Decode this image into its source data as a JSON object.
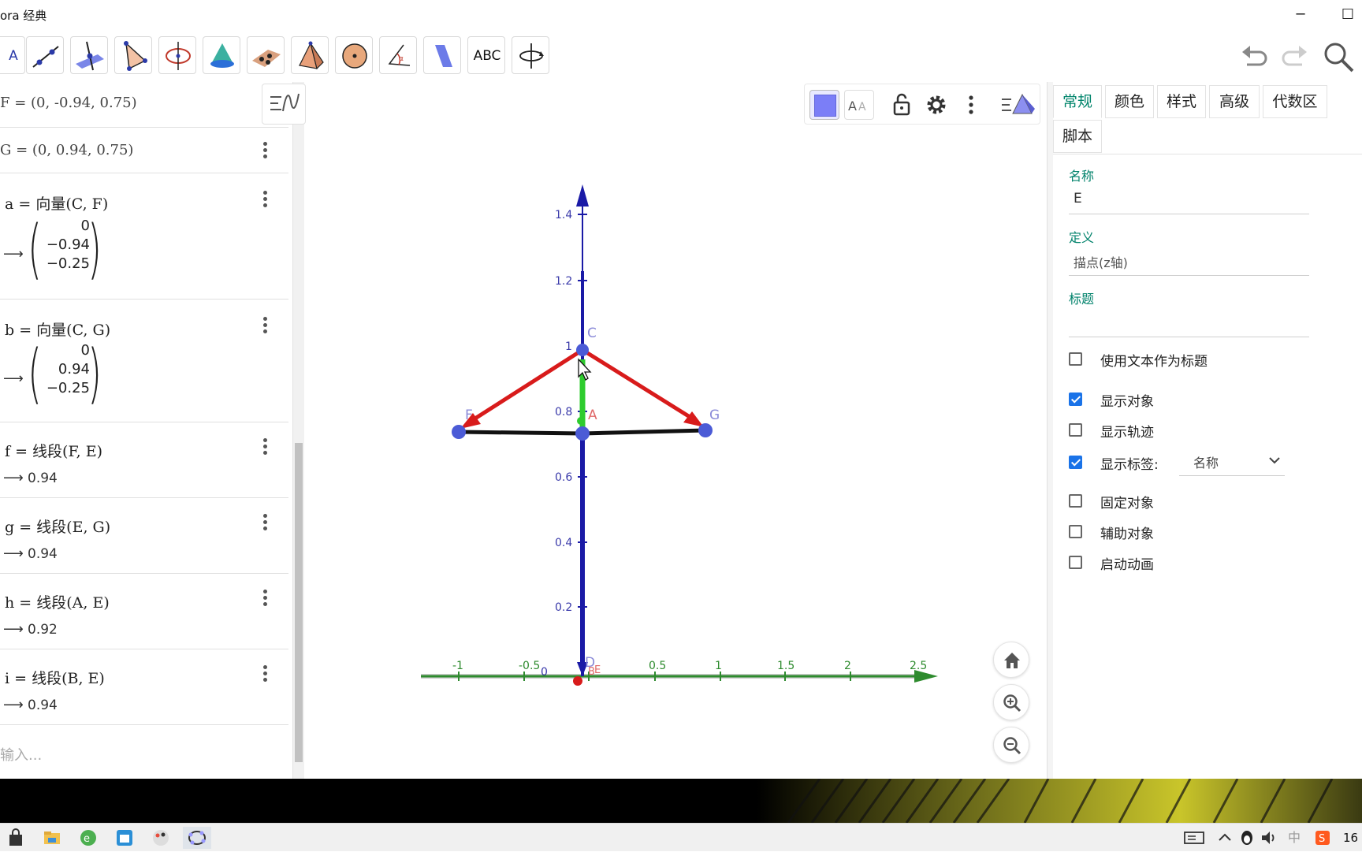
{
  "window": {
    "title": "ora 经典",
    "minimize": "─",
    "maximize": "☐"
  },
  "toolbar": {
    "tools": [
      "move-tool",
      "line-tool",
      "perpendicular-tool",
      "polygon-tool",
      "circle-axis-tool",
      "intersect-surfaces-tool",
      "plane-tool",
      "pyramid-tool",
      "sphere-tool",
      "angle-tool",
      "reflect-tool",
      "text-tool",
      "rotate-view-tool"
    ],
    "text_tool_label": "ABC",
    "move_tool_label": "A"
  },
  "algebra": {
    "rows": [
      {
        "def": "F = (0, -0.94, 0.75)"
      },
      {
        "def": "G = (0, 0.94, 0.75)"
      },
      {
        "def": "a = 向量(C, F)",
        "vector": [
          "0",
          "−0.94",
          "−0.25"
        ]
      },
      {
        "def": "b = 向量(C, G)",
        "vector": [
          "0",
          "0.94",
          "−0.25"
        ]
      },
      {
        "def": "f = 线段(F, E)",
        "value": "0.94"
      },
      {
        "def": "g = 线段(E, G)",
        "value": "0.94"
      },
      {
        "def": "h = 线段(A, E)",
        "value": "0.92"
      },
      {
        "def": "i = 线段(B, E)",
        "value": "0.94"
      }
    ],
    "arrow": "⟶",
    "input_placeholder": "输入..."
  },
  "graphics": {
    "z_ticks": [
      "1.4",
      "1.2",
      "1",
      "0.8",
      "0.6",
      "0.4",
      "0.2",
      "0"
    ],
    "y_ticks": [
      "-1",
      "-0.5",
      "0.5",
      "1",
      "1.5",
      "2",
      "2.5"
    ],
    "point_labels": {
      "C": "C",
      "F": "F",
      "G": "G",
      "A": "A",
      "D": "D",
      "B": "B",
      "E": "E"
    },
    "colors": {
      "vector": "#d81b1b",
      "axis_z": "#1a1aa6",
      "axis_y": "#2e8b2e",
      "point": "#4b5bd6",
      "segment": "#111111",
      "green_seg": "#2ecc2e"
    }
  },
  "properties": {
    "tabs": [
      "常规",
      "颜色",
      "样式",
      "高级",
      "代数区",
      "脚本"
    ],
    "active_tab": "常规",
    "name_label": "名称",
    "name_value": "E",
    "definition_label": "定义",
    "definition_value": "描点(z轴)",
    "caption_label": "标题",
    "caption_value": "",
    "checkboxes": [
      {
        "label": "使用文本作为标题",
        "checked": false
      },
      {
        "label": "显示对象",
        "checked": true
      },
      {
        "label": "显示轨迹",
        "checked": false
      },
      {
        "label": "显示标签:",
        "checked": true
      },
      {
        "label": "固定对象",
        "checked": false
      },
      {
        "label": "辅助对象",
        "checked": false
      },
      {
        "label": "启动动画",
        "checked": false
      }
    ],
    "label_mode": "名称"
  },
  "taskbar": {
    "clock": "16",
    "ime": "中"
  }
}
